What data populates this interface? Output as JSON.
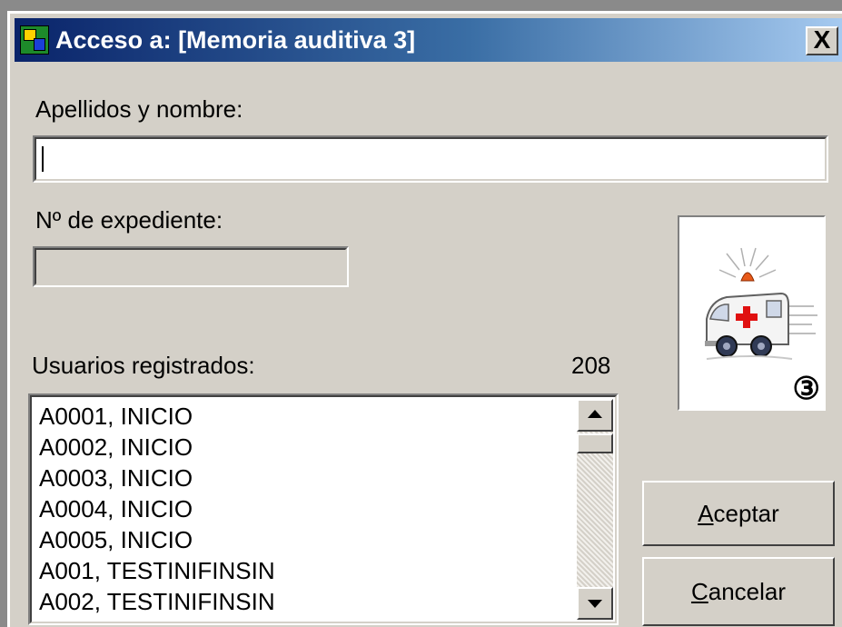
{
  "window": {
    "title": "Acceso a: [Memoria auditiva 3]",
    "close_label": "X"
  },
  "form": {
    "name_label": "Apellidos y nombre:",
    "name_value": "",
    "expediente_label": "Nº de expediente:",
    "expediente_value": "",
    "users_label": "Usuarios registrados:",
    "users_count": "208"
  },
  "users": [
    "A0001, INICIO",
    "A0002, INICIO",
    "A0003, INICIO",
    "A0004, INICIO",
    "A0005, INICIO",
    "A001, TESTINIFINSIN",
    "A002, TESTINIFINSIN"
  ],
  "picture": {
    "icon": "ambulance-icon",
    "badge": "③"
  },
  "buttons": {
    "accept_mnemonic": "A",
    "accept_rest": "ceptar",
    "cancel_mnemonic": "C",
    "cancel_rest": "ancelar"
  },
  "colors": {
    "dialog_bg": "#d4d0c8",
    "titlebar_start": "#0a246a",
    "titlebar_end": "#a6caf0"
  }
}
